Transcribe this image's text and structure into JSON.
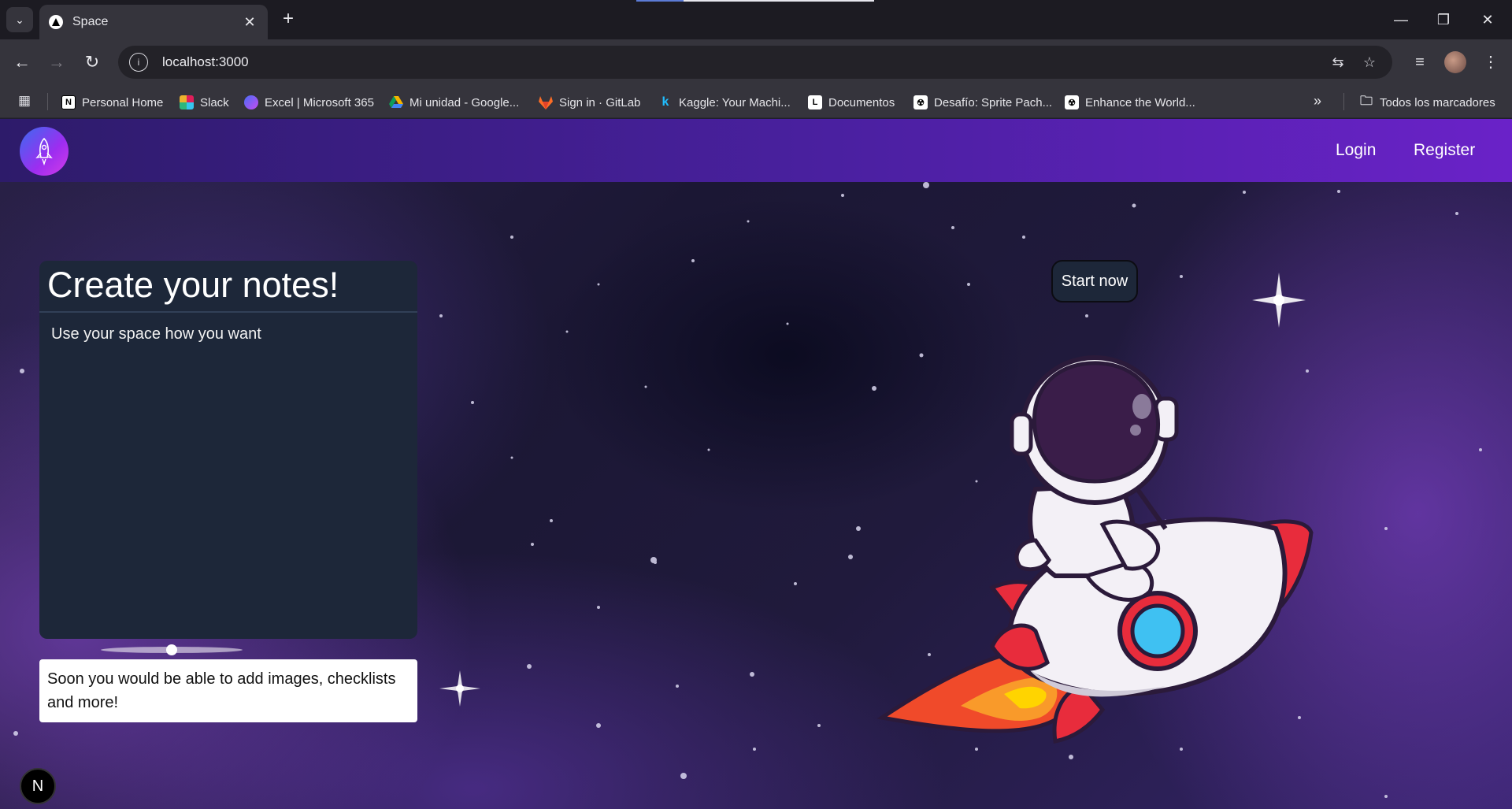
{
  "browser": {
    "tab": {
      "title": "Space"
    },
    "url": "localhost:3000",
    "bookmarks": [
      {
        "label": "Personal Home",
        "icon": "notion-icon",
        "color": "#ffffff"
      },
      {
        "label": "Slack",
        "icon": "slack-icon",
        "color": "#e01e5a"
      },
      {
        "label": "Excel | Microsoft 365",
        "icon": "microsoft-365-icon",
        "color": "#4a6cf7"
      },
      {
        "label": "Mi unidad - Google...",
        "icon": "google-drive-icon",
        "color": "#f4b400"
      },
      {
        "label": "Sign in · GitLab",
        "icon": "gitlab-icon",
        "color": "#fc6d26"
      },
      {
        "label": "Kaggle: Your Machi...",
        "icon": "kaggle-icon",
        "color": "#20beff"
      },
      {
        "label": "Documentos",
        "icon": "docs-icon",
        "color": "#ffffff"
      },
      {
        "label": "Desafío: Sprite Pach...",
        "icon": "sprite-icon",
        "color": "#ffffff"
      },
      {
        "label": "Enhance the World...",
        "icon": "enhance-icon",
        "color": "#ffffff"
      }
    ],
    "all_bookmarks_label": "Todos los marcadores"
  },
  "page": {
    "nav": {
      "login": "Login",
      "register": "Register"
    },
    "note_card": {
      "title": "Create your notes!",
      "body": "Use your space how you want"
    },
    "info_text": "Soon you would be able to add images, checklists and more!",
    "start_button": "Start now",
    "next_badge": "N"
  },
  "colors": {
    "navbar_start": "#2d1b6a",
    "navbar_end": "#6a22c8",
    "card_bg": "#1d2739",
    "logo_gradient": [
      "#3a6cf0",
      "#d43ce8"
    ]
  }
}
